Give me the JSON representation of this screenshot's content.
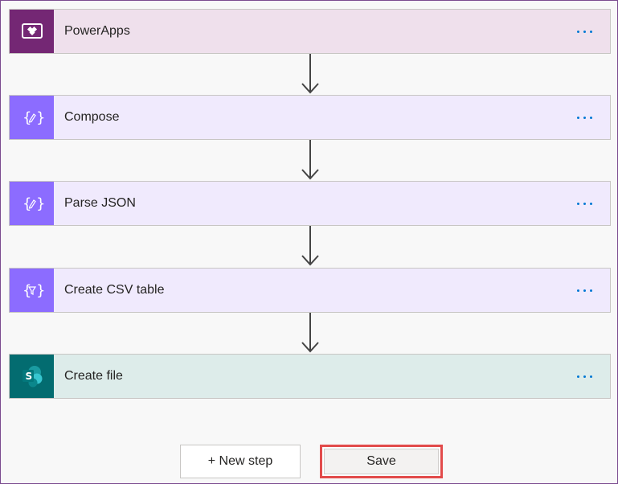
{
  "colors": {
    "powerapps_icon_bg": "#742774",
    "powerapps_card_bg": "#efe0ec",
    "data_op_icon_bg": "#8c6cff",
    "data_op_card_bg": "#f0eafd",
    "sharepoint_icon_bg": "#036c70",
    "sharepoint_card_bg": "#ddecea",
    "more_dots": "#0078d4",
    "save_highlight": "#e24b4b"
  },
  "steps": [
    {
      "title": "PowerApps",
      "icon": "powerapps-icon"
    },
    {
      "title": "Compose",
      "icon": "compose-icon"
    },
    {
      "title": "Parse JSON",
      "icon": "parse-json-icon"
    },
    {
      "title": "Create CSV table",
      "icon": "create-csv-icon"
    },
    {
      "title": "Create file",
      "icon": "sharepoint-icon"
    }
  ],
  "actions": {
    "new_step_label": "+ New step",
    "save_label": "Save"
  }
}
